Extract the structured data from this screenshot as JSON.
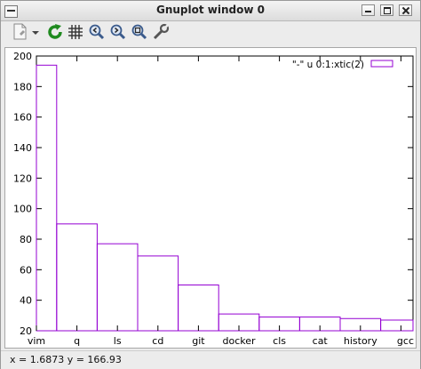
{
  "window": {
    "title": "Gnuplot window 0"
  },
  "toolbar": {
    "items": [
      {
        "name": "copy-to-clipboard-icon"
      },
      {
        "name": "dropdown-arrow-icon"
      },
      {
        "name": "replot-icon"
      },
      {
        "name": "grid-icon"
      },
      {
        "name": "zoom-previous-icon"
      },
      {
        "name": "zoom-next-icon"
      },
      {
        "name": "autoscale-icon"
      },
      {
        "name": "settings-wrench-icon"
      }
    ]
  },
  "statusbar": {
    "coordinates": "x = 1.6873 y = 166.93"
  },
  "chart_data": {
    "type": "bar",
    "categories": [
      "vim",
      "q",
      "ls",
      "cd",
      "git",
      "docker",
      "cls",
      "cat",
      "history",
      "gcc"
    ],
    "series": [
      {
        "name": "\"-\" u 0:1:xtic(2)",
        "values": [
          194,
          90,
          77,
          69,
          50,
          31,
          29,
          29,
          28,
          27
        ]
      }
    ],
    "ylim": [
      20,
      200
    ],
    "yticks": [
      20,
      40,
      60,
      80,
      100,
      120,
      140,
      160,
      180,
      200
    ],
    "xlabel": "",
    "ylabel": "",
    "grid": false,
    "legend_position": "top-right",
    "colors": {
      "series": "#9400d3",
      "axes": "#000000"
    }
  }
}
